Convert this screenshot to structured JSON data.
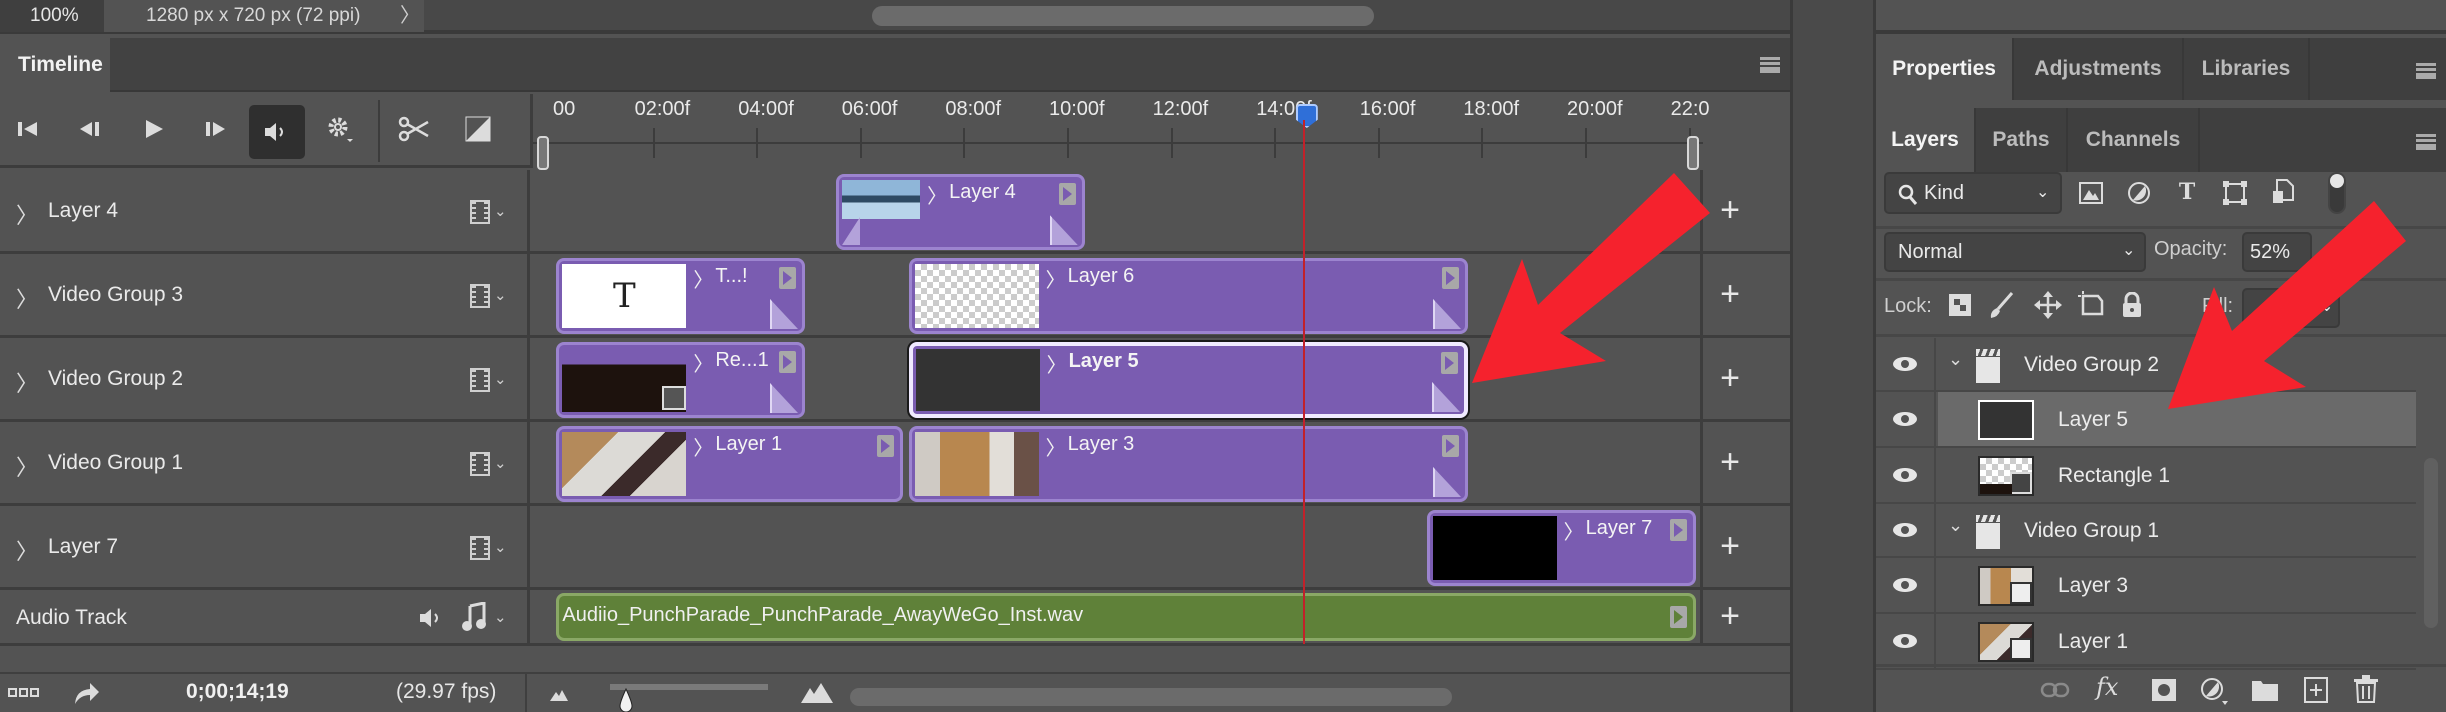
{
  "status_bar": {
    "zoom_level": "100%",
    "doc_info": "1280 px x 720 px (72 ppi)",
    "doc_info_arrow": "〉"
  },
  "timeline_panel": {
    "tab_label": "Timeline",
    "controls": {
      "first_frame": "go-to-first-frame",
      "prev_frame": "go-to-previous-frame",
      "play": "play",
      "next_frame": "go-to-next-frame",
      "mute": "mute-audio",
      "settings": "settings",
      "split": "split-at-playhead",
      "transition": "transition"
    },
    "ruler": {
      "labels": [
        "00",
        "02:00f",
        "04:00f",
        "06:00f",
        "08:00f",
        "10:00f",
        "12:00f",
        "14:00f",
        "16:00f",
        "18:00f",
        "20:00f",
        "22:0"
      ],
      "seconds_per_label": 2,
      "playhead_seconds": 14.63
    },
    "tracks": [
      {
        "name": "Layer 4",
        "chevron": "〉",
        "clips": [
          {
            "name": "Layer 4",
            "start": 5.6,
            "end": 10.4,
            "thumb": "city"
          }
        ]
      },
      {
        "name": "Video Group 3",
        "chevron": "〉",
        "clips": [
          {
            "name": "T...!",
            "start": 0.2,
            "end": 5.0,
            "thumb": "text"
          },
          {
            "name": "Layer 6",
            "start": 7.0,
            "end": 17.8,
            "thumb": "transparent"
          }
        ]
      },
      {
        "name": "Video Group 2",
        "chevron": "〉",
        "clips": [
          {
            "name": "Re...1",
            "start": 0.2,
            "end": 5.0,
            "thumb": "rectangle"
          },
          {
            "name": "Layer 5",
            "start": 7.0,
            "end": 17.8,
            "thumb": "dark",
            "selected": true
          }
        ]
      },
      {
        "name": "Video Group 1",
        "chevron": "〉",
        "clips": [
          {
            "name": "Layer 1",
            "start": 0.2,
            "end": 6.9,
            "thumb": "photo1"
          },
          {
            "name": "Layer 3",
            "start": 7.0,
            "end": 17.8,
            "thumb": "photo2"
          }
        ]
      },
      {
        "name": "Layer 7",
        "chevron": "〉",
        "clips": [
          {
            "name": "Layer 7",
            "start": 17.0,
            "end": 22.2,
            "thumb": "black"
          }
        ]
      }
    ],
    "audio_track": {
      "name": "Audio Track",
      "clip": {
        "name": "Audiio_PunchParade_PunchParade_AwayWeGo_Inst.wav",
        "start": 0.2,
        "end": 22.2
      }
    },
    "add_media_label": "+",
    "bottom": {
      "timecode": "0;00;14;19",
      "fps": "(29.97 fps)",
      "zoom_slider_position": 0.1
    }
  },
  "right_panel": {
    "top_tabs": [
      {
        "label": "Properties",
        "active": true
      },
      {
        "label": "Adjustments",
        "active": false
      },
      {
        "label": "Libraries",
        "active": false
      }
    ],
    "layer_tabs": [
      {
        "label": "Layers",
        "active": true
      },
      {
        "label": "Paths",
        "active": false
      },
      {
        "label": "Channels",
        "active": false
      }
    ],
    "filter": {
      "kind_label": "Kind"
    },
    "blend_mode": "Normal",
    "opacity_label": "Opacity:",
    "opacity_value": "52%",
    "lock_label": "Lock:",
    "fill_label": "Fill:",
    "layers": [
      {
        "name": "Video Group 2",
        "type": "video-group",
        "expanded": true,
        "selected": false
      },
      {
        "name": "Layer 5",
        "type": "layer",
        "thumb": "dark",
        "selected": true
      },
      {
        "name": "Rectangle 1",
        "type": "shape",
        "thumb": "rectangle",
        "selected": false
      },
      {
        "name": "Video Group 1",
        "type": "video-group",
        "expanded": true,
        "selected": false
      },
      {
        "name": "Layer 3",
        "type": "smart-object",
        "thumb": "photo2",
        "selected": false
      },
      {
        "name": "Layer 1",
        "type": "smart-object",
        "thumb": "photo1",
        "selected": false
      }
    ]
  },
  "colors": {
    "clip_video": "#7a5cb1",
    "clip_audio": "#5f8139",
    "playhead": "#c2212a",
    "playhead_head": "#2f6fd8",
    "annotation_arrow": "#f5222d"
  }
}
